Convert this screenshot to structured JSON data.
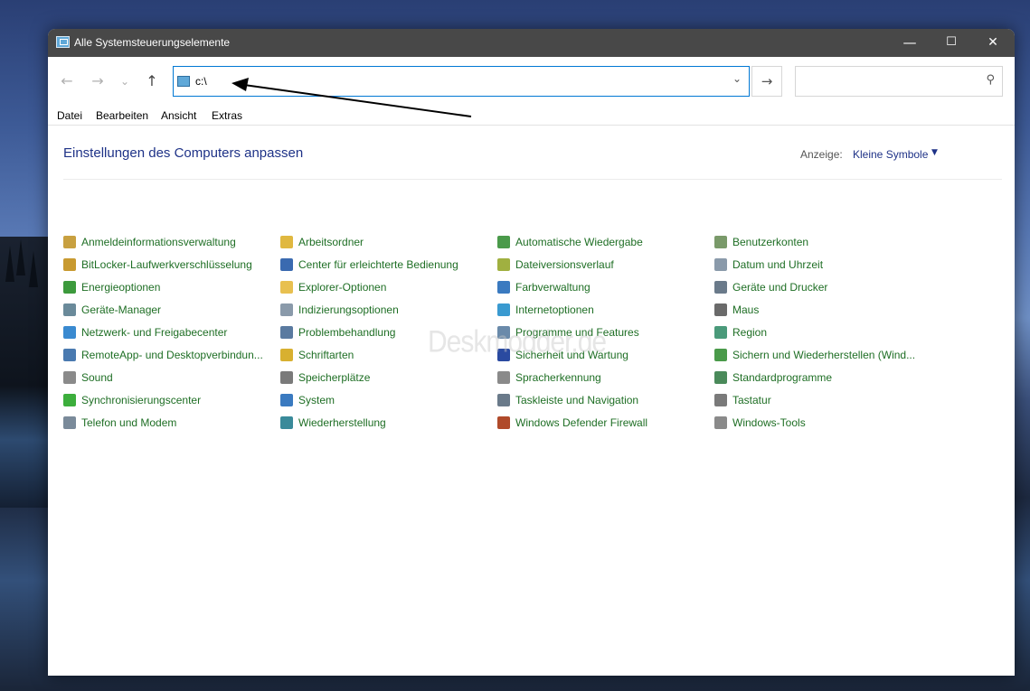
{
  "window": {
    "title": "Alle Systemsteuerungselemente",
    "caption_minimize": "—",
    "caption_maximize": "☐",
    "caption_close": "✕"
  },
  "nav": {
    "back_glyph": "←",
    "forward_glyph": "→",
    "recent_glyph": "⌄",
    "up_glyph": "↑",
    "address_value": "c:\\",
    "address_dropdown_glyph": "⌄",
    "go_glyph": "→",
    "search_placeholder": "",
    "search_glyph": "⚲"
  },
  "menu": [
    "Datei",
    "Bearbeiten",
    "Ansicht",
    "Extras"
  ],
  "header": {
    "title": "Einstellungen des Computers anpassen",
    "view_label": "Anzeige:",
    "view_value": "Kleine Symbole"
  },
  "watermark": "Deskmodder.de",
  "colors": {
    "link_green": "#1e6e24",
    "title_blue": "#1e3287",
    "accent": "#0078d4",
    "titlebar": "#484848"
  },
  "columns": [
    [
      {
        "label": "Anmeldeinformationsverwaltung",
        "icon": "credential-icon",
        "color": "#c8a040"
      },
      {
        "label": "BitLocker-Laufwerkverschlüsselung",
        "icon": "bitlocker-icon",
        "color": "#c89a30"
      },
      {
        "label": "Energieoptionen",
        "icon": "power-icon",
        "color": "#3c9a3c"
      },
      {
        "label": "Geräte-Manager",
        "icon": "device-manager-icon",
        "color": "#6a8a9a"
      },
      {
        "label": "Netzwerk- und Freigabecenter",
        "icon": "network-icon",
        "color": "#3a8ad0"
      },
      {
        "label": "RemoteApp- und Desktopverbindun...",
        "icon": "remote-desktop-icon",
        "color": "#4a7ab0"
      },
      {
        "label": "Sound",
        "icon": "sound-icon",
        "color": "#8a8a8a"
      },
      {
        "label": "Synchronisierungscenter",
        "icon": "sync-icon",
        "color": "#3cae3c"
      },
      {
        "label": "Telefon und Modem",
        "icon": "phone-icon",
        "color": "#7a8a9a"
      }
    ],
    [
      {
        "label": "Arbeitsordner",
        "icon": "work-folder-icon",
        "color": "#e0b840"
      },
      {
        "label": "Center für erleichterte Bedienung",
        "icon": "ease-of-access-icon",
        "color": "#3a6ab0"
      },
      {
        "label": "Explorer-Optionen",
        "icon": "folder-options-icon",
        "color": "#e8c050"
      },
      {
        "label": "Indizierungsoptionen",
        "icon": "indexing-icon",
        "color": "#8a9aaa"
      },
      {
        "label": "Problembehandlung",
        "icon": "troubleshoot-icon",
        "color": "#5a7aa0"
      },
      {
        "label": "Schriftarten",
        "icon": "fonts-icon",
        "color": "#d8b030"
      },
      {
        "label": "Speicherplätze",
        "icon": "storage-icon",
        "color": "#7a7a7a"
      },
      {
        "label": "System",
        "icon": "system-icon",
        "color": "#3a7ac0"
      },
      {
        "label": "Wiederherstellung",
        "icon": "recovery-icon",
        "color": "#3a8a9a"
      }
    ],
    [
      {
        "label": "Automatische Wiedergabe",
        "icon": "autoplay-icon",
        "color": "#4a9a4a"
      },
      {
        "label": "Dateiversionsverlauf",
        "icon": "file-history-icon",
        "color": "#a0b040"
      },
      {
        "label": "Farbverwaltung",
        "icon": "color-management-icon",
        "color": "#3a7ac0"
      },
      {
        "label": "Internetoptionen",
        "icon": "internet-options-icon",
        "color": "#3a9ad0"
      },
      {
        "label": "Programme und Features",
        "icon": "programs-icon",
        "color": "#6a8aaa"
      },
      {
        "label": "Sicherheit und Wartung",
        "icon": "security-flag-icon",
        "color": "#2a4aa0"
      },
      {
        "label": "Spracherkennung",
        "icon": "speech-icon",
        "color": "#8a8a8a"
      },
      {
        "label": "Taskleiste und Navigation",
        "icon": "taskbar-icon",
        "color": "#6a7a8a"
      },
      {
        "label": "Windows Defender Firewall",
        "icon": "firewall-icon",
        "color": "#b04a2a"
      }
    ],
    [
      {
        "label": "Benutzerkonten",
        "icon": "user-accounts-icon",
        "color": "#7a9a6a"
      },
      {
        "label": "Datum und Uhrzeit",
        "icon": "clock-icon",
        "color": "#8a9aaa"
      },
      {
        "label": "Geräte und Drucker",
        "icon": "printer-icon",
        "color": "#6a7a8a"
      },
      {
        "label": "Maus",
        "icon": "mouse-icon",
        "color": "#6a6a6a"
      },
      {
        "label": "Region",
        "icon": "region-icon",
        "color": "#4a9a7a"
      },
      {
        "label": "Sichern und Wiederherstellen (Wind...",
        "icon": "backup-icon",
        "color": "#4a9a4a"
      },
      {
        "label": "Standardprogramme",
        "icon": "default-programs-icon",
        "color": "#4a8a5a"
      },
      {
        "label": "Tastatur",
        "icon": "keyboard-icon",
        "color": "#7a7a7a"
      },
      {
        "label": "Windows-Tools",
        "icon": "windows-tools-icon",
        "color": "#8a8a8a"
      }
    ]
  ]
}
